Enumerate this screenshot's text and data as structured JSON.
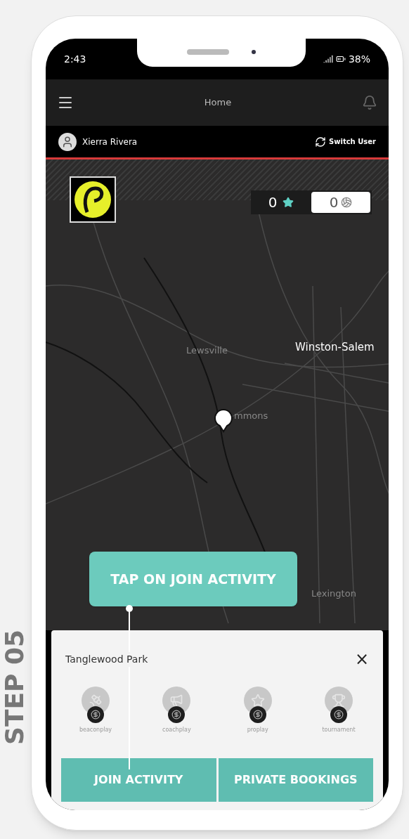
{
  "side_caption": "STEP 05",
  "status_bar": {
    "time": "2:43",
    "battery": "38%"
  },
  "header": {
    "title": "Home"
  },
  "user_bar": {
    "name": "Xierra Rivera",
    "switch_label": "Switch User"
  },
  "counters": [
    {
      "kind": "stars",
      "value": "0"
    },
    {
      "kind": "balls",
      "value": "0"
    }
  ],
  "map_labels": [
    {
      "text": "Lewsville",
      "kind": "town"
    },
    {
      "text": "Winston-Salem",
      "kind": "city"
    },
    {
      "text": "mmons",
      "kind": "town"
    },
    {
      "text": "Lexington",
      "kind": "town"
    }
  ],
  "callout": {
    "text": "TAP ON JOIN ACTIVITY"
  },
  "panel": {
    "title": "Tanglewood Park",
    "close": "×",
    "activities": [
      {
        "kind": "beacon",
        "label": "beaconplay"
      },
      {
        "kind": "coach",
        "label": "coachplay"
      },
      {
        "kind": "pro",
        "label": "proplay"
      },
      {
        "kind": "tournament",
        "label": "tournament"
      }
    ],
    "buttons": [
      "JOIN ACTIVITY",
      "PRIVATE BOOKINGS"
    ]
  }
}
